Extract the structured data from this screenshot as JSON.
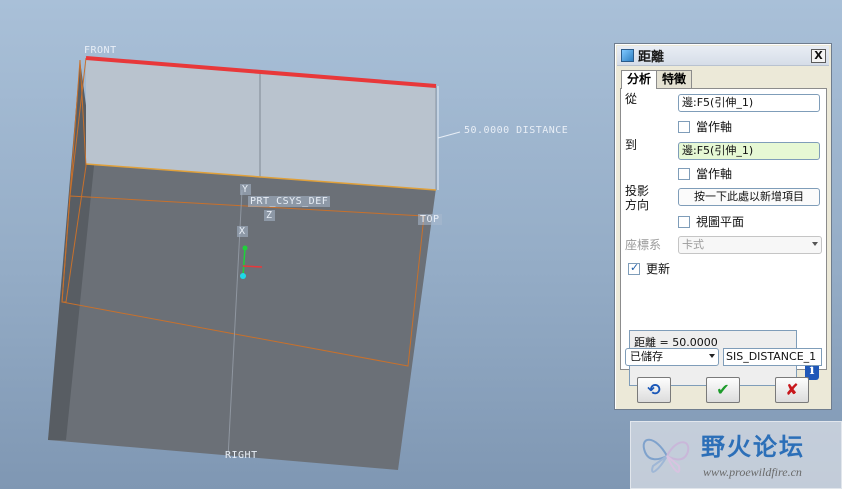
{
  "viewport": {
    "labels": {
      "front": "FRONT",
      "distance": "50.0000  DISTANCE",
      "csys": "PRT_CSYS_DEF",
      "top": "TOP",
      "right": "RIGHT",
      "y_axis": "Y",
      "z_axis": "Z",
      "x_axis": "X"
    },
    "colors": {
      "body_dark": "#6b7077",
      "body_top": "#b9c3ce",
      "selected_edge": "#e8383a",
      "datum_plane": "#c8712c",
      "csys_green": "#1fd13a",
      "csys_cyan": "#1fd8e8",
      "csys_red": "#e8383a"
    }
  },
  "dialog": {
    "title": "距離",
    "close_label": "X",
    "tabs": [
      {
        "label": "分析",
        "active": true
      },
      {
        "label": "特徵",
        "active": false
      }
    ],
    "from": {
      "label": "從",
      "value": "邊:F5(引伸_1)",
      "as_axis_label": "當作軸",
      "as_axis_checked": false
    },
    "to": {
      "label": "到",
      "value": "邊:F5(引伸_1)",
      "as_axis_label": "當作軸",
      "as_axis_checked": false
    },
    "projection": {
      "label_line1": "投影",
      "label_line2": "方向",
      "button_label": "按一下此處以新增項目",
      "view_plane_label": "視圖平面",
      "view_plane_checked": false
    },
    "csys": {
      "label": "座標系",
      "value": "卡式"
    },
    "update": {
      "label": "更新",
      "checked": true
    },
    "result_text": "距離 = 50.0000",
    "info_icon_glyph": "i",
    "saved_select": "已儲存",
    "feature_name": "SIS_DISTANCE_1",
    "buttons": {
      "repeat_glyph": "⟲",
      "ok_glyph": "✔",
      "cancel_glyph": "✘"
    }
  },
  "watermark": {
    "title": "野火论坛",
    "url": "www.proewildfire.cn"
  }
}
